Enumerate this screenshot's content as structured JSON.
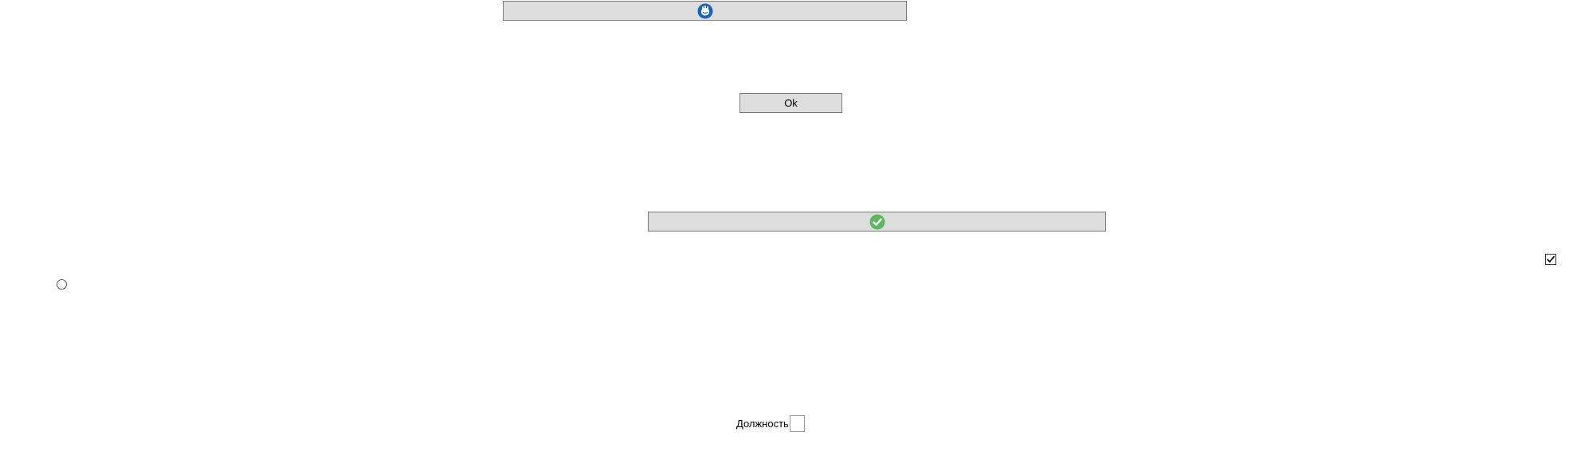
{
  "buttons": {
    "top": {
      "icon": "refresh-hand-icon",
      "label": ""
    },
    "ok": {
      "label": "Ok"
    },
    "confirm": {
      "icon": "green-check-icon",
      "label": ""
    }
  },
  "checkbox": {
    "checked": true
  },
  "radio": {
    "selected": false
  },
  "field": {
    "label": "Должность",
    "value": ""
  },
  "colors": {
    "button_bg": "#dddddd",
    "button_border": "#7a7a7a",
    "blue_icon": "#1565c0",
    "green_icon": "#5cb85c"
  }
}
